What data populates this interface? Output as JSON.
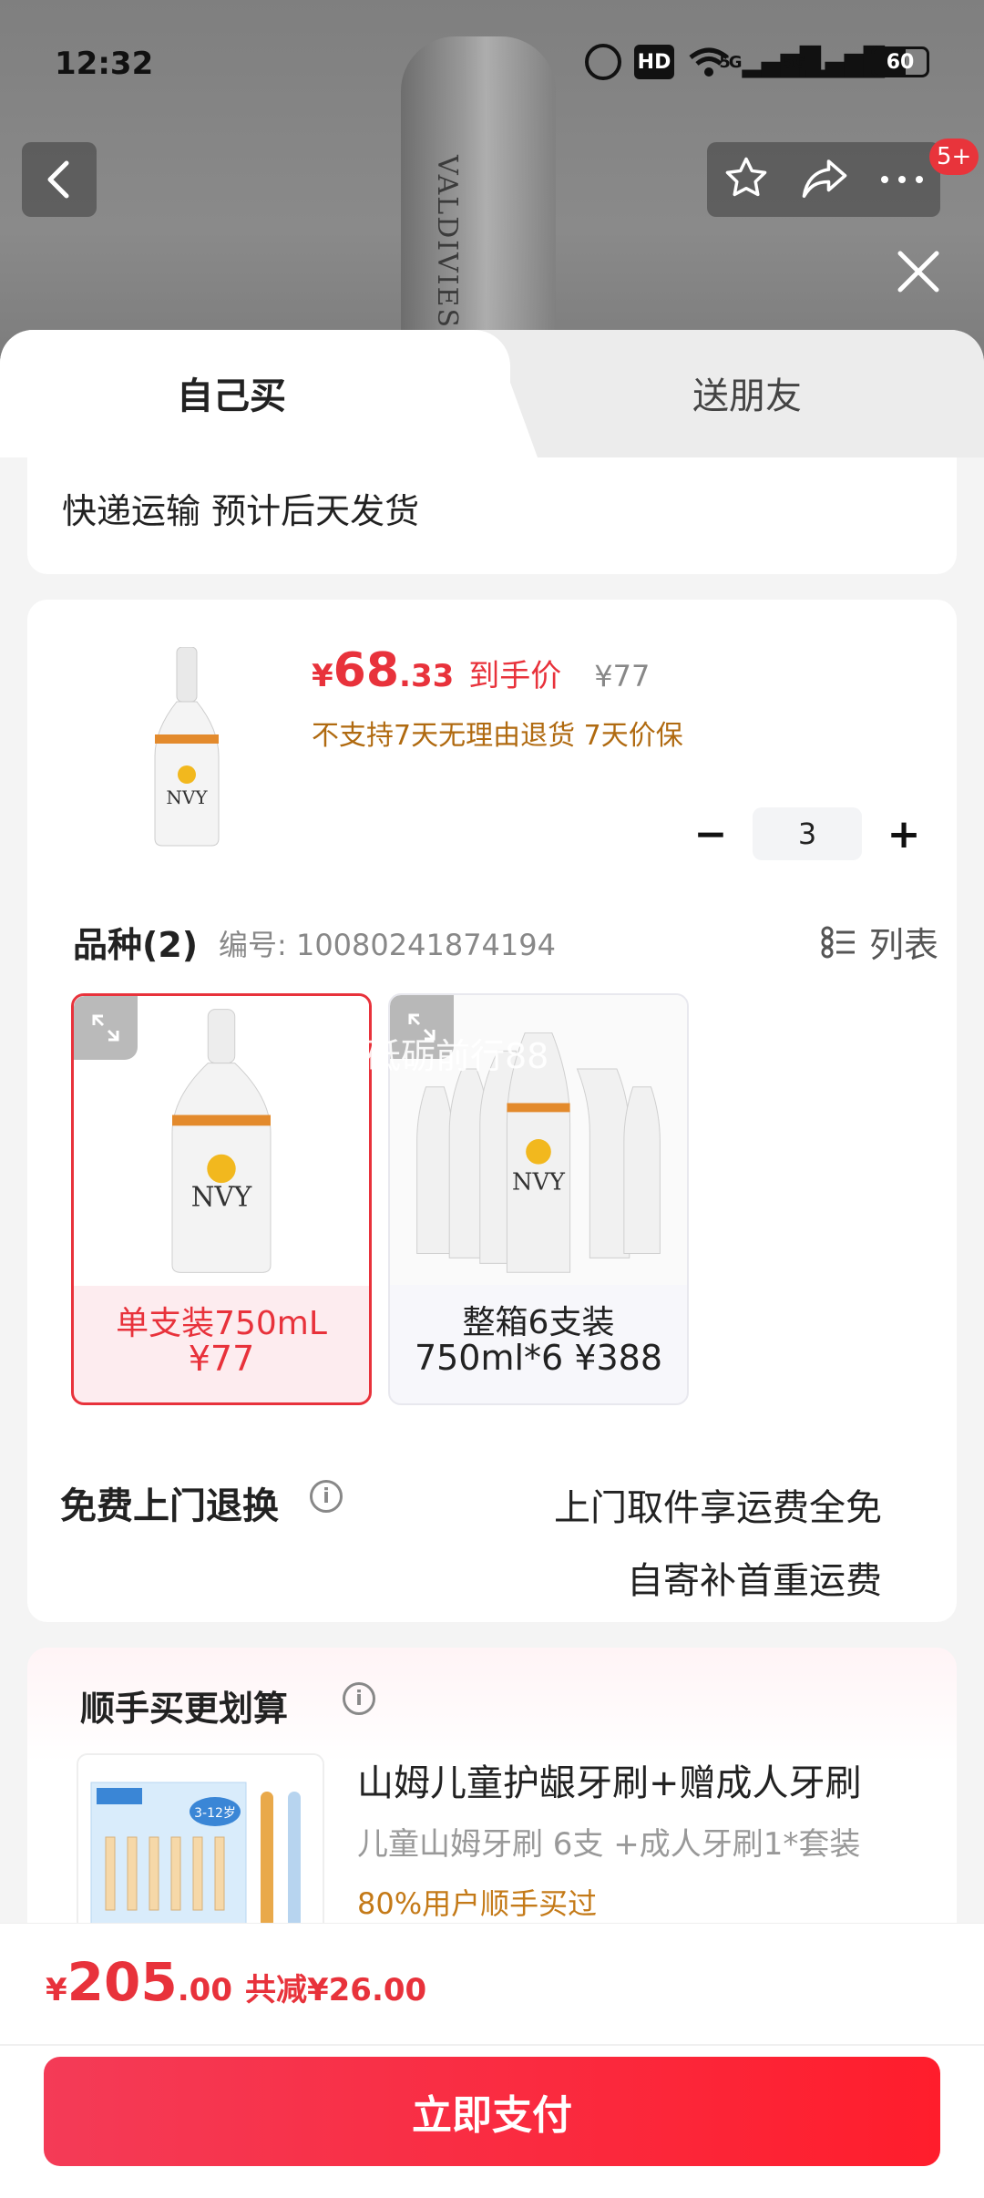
{
  "status_bar": {
    "time": "12:32",
    "hd": "HD",
    "signal1": "5G",
    "signal2": "5G",
    "battery": "60"
  },
  "background": {
    "bottle_text": "VALDIVIESO"
  },
  "nav": {
    "badge": "5+"
  },
  "tabs": {
    "self": "自己买",
    "gift": "送朋友"
  },
  "shipping": {
    "text": "快递运输 预计后天发货"
  },
  "product": {
    "price_symbol": "¥",
    "price_int": "68",
    "price_dec": ".33",
    "price_tag": "到手价",
    "original_price": "¥77",
    "promo": "不支持7天无理由退货  7天价保",
    "quantity": "3",
    "qty_minus": "−",
    "qty_plus": "+"
  },
  "variants": {
    "title": "品种(2)",
    "code": "编号: 10080241874194",
    "list_label": "列表",
    "items": [
      {
        "line1": "单支装750mL",
        "line2": "¥77"
      },
      {
        "line1": "整箱6支装",
        "line2": "750ml*6 ¥388"
      }
    ],
    "bottle_brand": "NVY",
    "watermark": "砥砺前行88"
  },
  "returns": {
    "title": "免费上门退换",
    "line1": "上门取件享运费全免",
    "line2": "自寄补首重运费"
  },
  "upsell": {
    "title": "顺手买更划算",
    "product_name": "山姆儿童护龈牙刷+赠成人牙刷",
    "product_sub": "儿童山姆牙刷 6支 +成人牙刷1*套装",
    "hint": "80%用户顺手买过",
    "thumb_badge": "3-12岁"
  },
  "footer": {
    "total_symbol": "¥",
    "total_int": "205",
    "total_dec": ".00",
    "saving": "共减¥26.00",
    "pay_button": "立即支付"
  },
  "colors": {
    "accent": "#e8323b",
    "promo": "#b06a10",
    "pay_gradient_start": "#f43b57",
    "pay_gradient_end": "#ff1d2c"
  }
}
